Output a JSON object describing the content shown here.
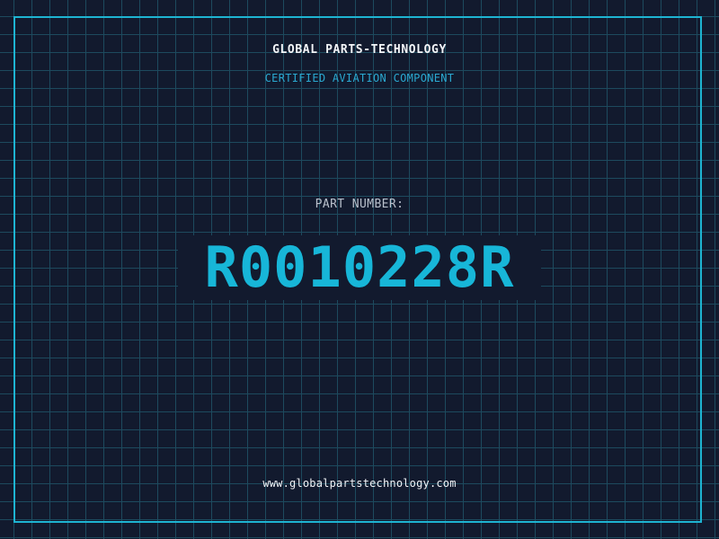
{
  "header": {
    "company": "GLOBAL PARTS-TECHNOLOGY",
    "subtitle": "CERTIFIED AVIATION COMPONENT"
  },
  "part": {
    "label": "PART NUMBER:",
    "number": "R0010228R"
  },
  "footer": {
    "url": "www.globalpartstechnology.com"
  },
  "colors": {
    "background": "#121a2e",
    "grid": "#1d4a5e",
    "accent": "#1eb4d2",
    "text": "#f2f4f7"
  }
}
